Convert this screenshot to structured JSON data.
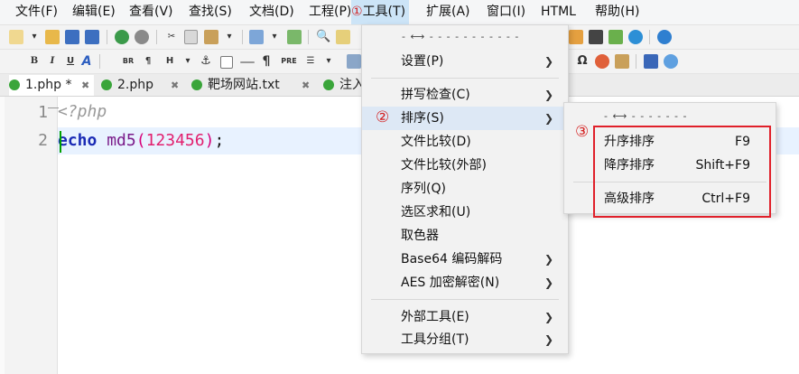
{
  "menubar": {
    "items": [
      {
        "label": "文件(F)"
      },
      {
        "label": "编辑(E)"
      },
      {
        "label": "查看(V)"
      },
      {
        "label": "查找(S)"
      },
      {
        "label": "文档(D)"
      },
      {
        "label": "工程(P)"
      },
      {
        "label": "工具(T)",
        "badge": "①"
      },
      {
        "label": "扩展(A)"
      },
      {
        "label": "窗口(I)"
      },
      {
        "label": "HTML"
      },
      {
        "label": "帮助(H)"
      }
    ]
  },
  "toolbar2": {
    "b": "B",
    "i": "I",
    "u": "U",
    "a": "A",
    "br": "BR",
    "para": "¶",
    "h": "H",
    "pre": "PRE"
  },
  "tabs": [
    {
      "label": "1.php *",
      "close": "✖"
    },
    {
      "label": "2.php",
      "close": "✖"
    },
    {
      "label": "靶场网站.txt",
      "close": "✖"
    },
    {
      "label": "注入",
      "close": ""
    }
  ],
  "editor": {
    "line_numbers": [
      "1",
      "2"
    ],
    "line1": "<?php",
    "line2": {
      "kw": "echo",
      "fn": "md5",
      "open": "(",
      "num": "123456",
      "close": ")",
      "end": ";"
    }
  },
  "tools_menu": {
    "tear": "- ⟷ - - - - - - - - - - -",
    "items": [
      {
        "label": "设置(P)",
        "submenu": true
      },
      {
        "label": "拼写检查(C)",
        "submenu": true
      },
      {
        "label": "排序(S)",
        "submenu": true,
        "badge": "②",
        "highlighted": true
      },
      {
        "label": "文件比较(D)",
        "submenu": false
      },
      {
        "label": "文件比较(外部)",
        "submenu": false
      },
      {
        "label": "序列(Q)",
        "submenu": false
      },
      {
        "label": "选区求和(U)",
        "submenu": false
      },
      {
        "label": "取色器",
        "submenu": false
      },
      {
        "label": "Base64 编码解码",
        "submenu": true
      },
      {
        "label": "AES 加密解密(N)",
        "submenu": true
      },
      {
        "label": "外部工具(E)",
        "submenu": true
      },
      {
        "label": "工具分组(T)",
        "submenu": true
      }
    ]
  },
  "sort_menu": {
    "tear": "- ⟷ - - - - - - -",
    "badge": "③",
    "items": [
      {
        "label": "升序排序",
        "shortcut": "F9"
      },
      {
        "label": "降序排序",
        "shortcut": "Shift+F9"
      },
      {
        "label": "高级排序",
        "shortcut": "Ctrl+F9"
      }
    ]
  },
  "icons": [
    "new-file-icon",
    "open-folder-icon",
    "save-icon",
    "save-all-icon",
    "undo-icon",
    "redo-icon",
    "cut-icon",
    "copy-icon",
    "paste-icon",
    "wrap-icon",
    "find-icon",
    "help-icon"
  ],
  "colors": {
    "accent_highlight": "#cce4f7",
    "annotation_red": "#e0202a",
    "keyword": "#1b2bb5"
  }
}
